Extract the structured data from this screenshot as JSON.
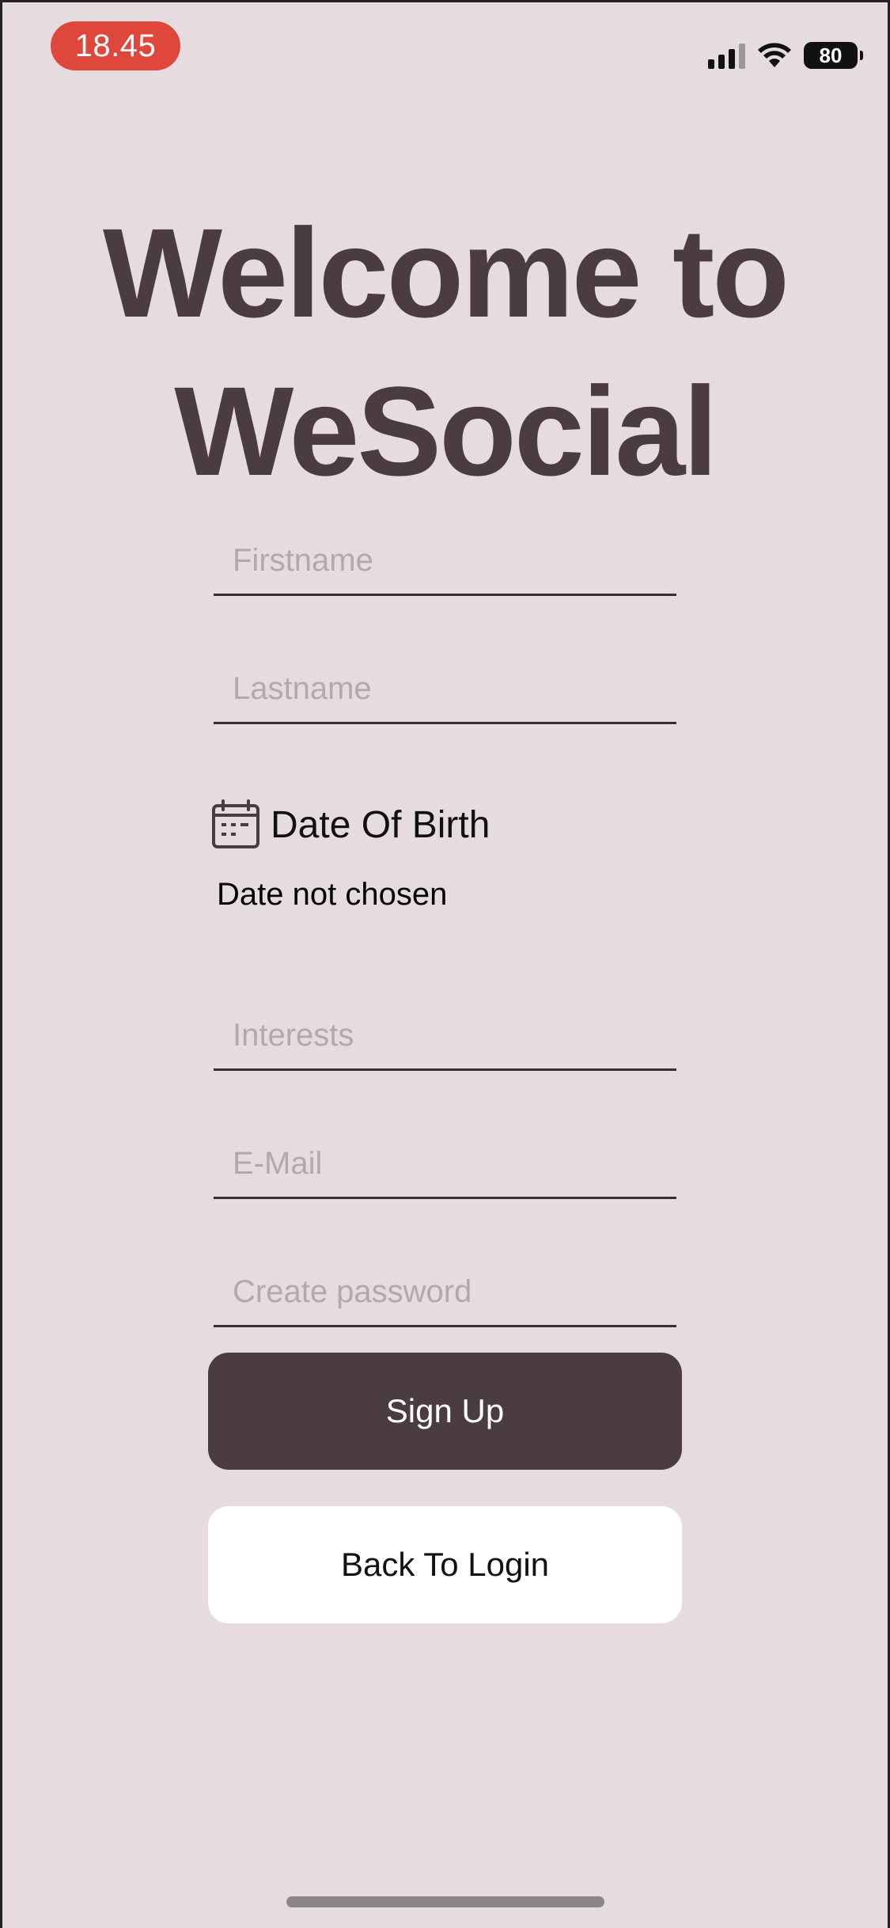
{
  "status_bar": {
    "time": "18.45",
    "battery_level": "80",
    "signal_icon": "cellular-signal-icon",
    "wifi_icon": "wifi-icon",
    "battery_icon": "battery-icon"
  },
  "header": {
    "title_line1": "Welcome to",
    "title_line2": "WeSocial"
  },
  "form": {
    "firstname_placeholder": "Firstname",
    "lastname_placeholder": "Lastname",
    "dob_icon": "calendar-icon",
    "dob_label": "Date Of Birth",
    "dob_status": "Date not chosen",
    "interests_placeholder": "Interests",
    "email_placeholder": "E-Mail",
    "password_placeholder": "Create password"
  },
  "actions": {
    "signup_label": "Sign Up",
    "back_label": "Back To Login"
  },
  "colors": {
    "background": "#e6dcdf",
    "accent": "#4b3c42",
    "time_pill": "#e0473c",
    "placeholder": "#b3a9ac"
  }
}
